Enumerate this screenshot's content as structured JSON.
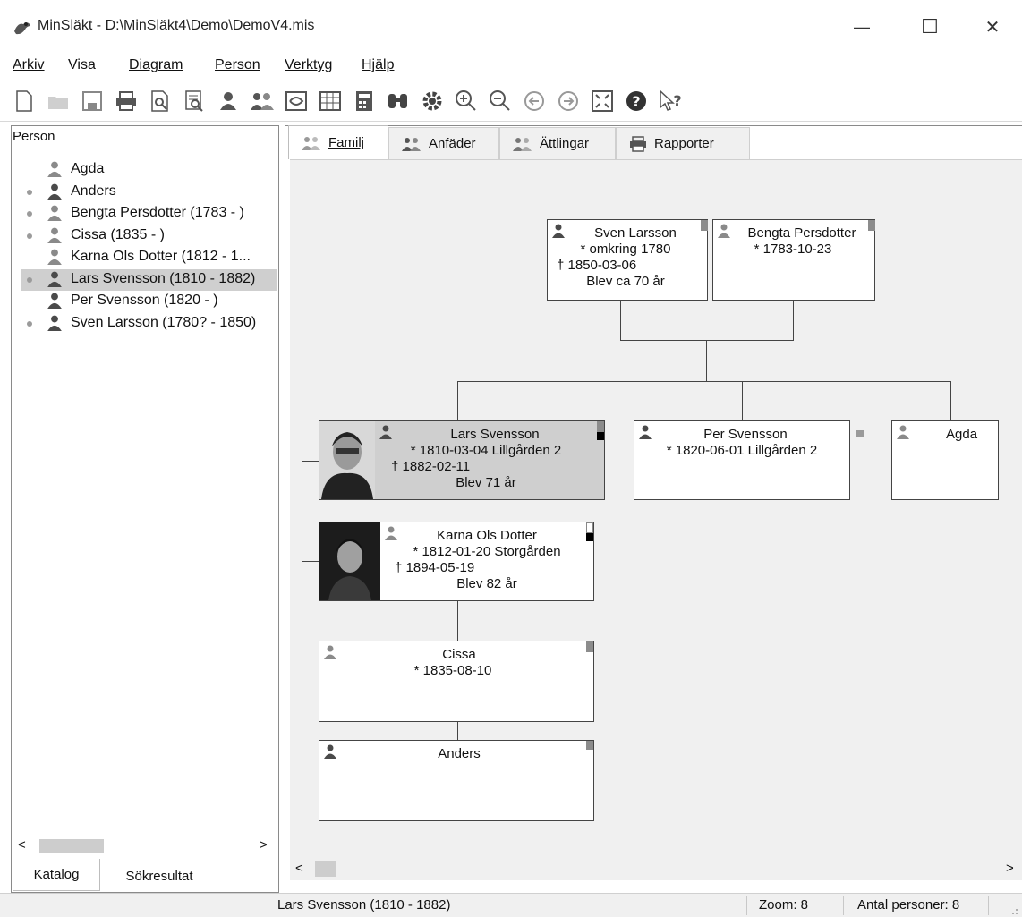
{
  "window": {
    "title": "MinSläkt - D:\\MinSläkt4\\Demo\\DemoV4.mis",
    "minimize_glyph": "—",
    "maximize_glyph": "☐",
    "close_glyph": "✕"
  },
  "menu": [
    "Arkiv",
    "Visa",
    "Diagram",
    "Person",
    "Verktyg",
    "Hjälp"
  ],
  "toolbar_icons": [
    "new-icon",
    "open-icon",
    "save-icon",
    "print-icon",
    "print-preview-icon",
    "report-preview-icon",
    "person-icon",
    "family-icon",
    "relation-icon",
    "grid-icon",
    "calculator-icon",
    "find-icon",
    "settings-icon",
    "zoom-in-icon",
    "zoom-out-icon",
    "back-icon",
    "forward-icon",
    "fit-icon",
    "help-icon",
    "context-help-icon"
  ],
  "left": {
    "header": "Person",
    "persons": [
      {
        "label": "Agda",
        "dot": false,
        "gender": "female"
      },
      {
        "label": "Anders",
        "dot": true,
        "gender": "male"
      },
      {
        "label": "Bengta Persdotter (1783 - )",
        "dot": true,
        "gender": "female"
      },
      {
        "label": "Cissa (1835 - )",
        "dot": true,
        "gender": "female"
      },
      {
        "label": "Karna Ols Dotter (1812 - 1...",
        "dot": false,
        "gender": "female"
      },
      {
        "label": "Lars Svensson (1810 - 1882)",
        "dot": true,
        "gender": "male",
        "selected": true
      },
      {
        "label": "Per Svensson (1820 - )",
        "dot": false,
        "gender": "male"
      },
      {
        "label": "Sven Larsson (1780? - 1850)",
        "dot": true,
        "gender": "male"
      }
    ],
    "tabs": [
      "Katalog",
      "Sökresultat"
    ],
    "scroll_left": "<",
    "scroll_right": ">"
  },
  "tabs": [
    "Familj",
    "Anfäder",
    "Ättlingar",
    "Rapporter"
  ],
  "tree": {
    "father": {
      "name": "Sven Larsson",
      "lines": [
        "* omkring 1780",
        "† 1850-03-06",
        "Blev ca 70 år"
      ]
    },
    "mother": {
      "name": "Bengta Persdotter",
      "lines": [
        "* 1783-10-23"
      ]
    },
    "main": {
      "name": "Lars Svensson",
      "lines": [
        "* 1810-03-04 Lillgården 2",
        "† 1882-02-11",
        "Blev 71 år"
      ]
    },
    "sibling1": {
      "name": "Per Svensson",
      "lines": [
        "* 1820-06-01 Lillgården 2"
      ]
    },
    "sibling2": {
      "name": "Agda",
      "lines": []
    },
    "spouse": {
      "name": "Karna Ols Dotter",
      "lines": [
        "* 1812-01-20 Storgården",
        "† 1894-05-19",
        "Blev 82 år"
      ]
    },
    "child1": {
      "name": "Cissa",
      "lines": [
        "* 1835-08-10"
      ]
    },
    "child2": {
      "name": "Anders",
      "lines": []
    }
  },
  "status": {
    "current": "Lars Svensson (1810 - 1882)",
    "zoom": "Zoom: 8",
    "count": "Antal personer: 8"
  },
  "colors": {
    "male_icon": "#4a4a4a",
    "female_icon": "#8a8a8a",
    "highlight": "#cfcfcf",
    "canvas_bg": "#f0f0f0"
  }
}
